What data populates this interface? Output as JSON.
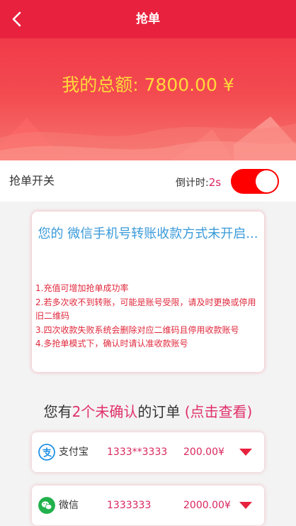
{
  "header": {
    "title": "抢单",
    "back_icon": "chevron-left-icon"
  },
  "hero": {
    "total_text": "我的总额: 7800.00 ¥"
  },
  "switch_row": {
    "label": "抢单开关",
    "countdown_label": "倒计时:",
    "countdown_value": "2s",
    "toggle_on": true,
    "toggle_color": "#ff0000"
  },
  "notice": {
    "title": "您的 微信手机号转账收款方式未开启...",
    "rules": [
      "1.充值可增加抢单成功率",
      "2.若多次收不到转账，可能是账号受限，请及时更换或停用旧二维码",
      "3.四次收款失败系统会删除对应二维码且停用收款账号",
      "4.多抢单模式下，确认时请认准收款账号"
    ]
  },
  "orders_header": {
    "prefix": "您有",
    "count": "2个",
    "status": "未确认",
    "suffix": "的订单 ",
    "action": "(点击查看)"
  },
  "orders": [
    {
      "method": "支付宝",
      "icon": "alipay-icon",
      "account": "1333**3333",
      "amount": "200.00¥"
    },
    {
      "method": "微信",
      "icon": "wechat-icon",
      "account": "1333333",
      "amount": "2000.00¥"
    }
  ],
  "colors": {
    "brand_red": "#e8223e",
    "gold": "#ffd93b",
    "pink": "#d8265e",
    "link_blue": "#3a9ad9"
  }
}
